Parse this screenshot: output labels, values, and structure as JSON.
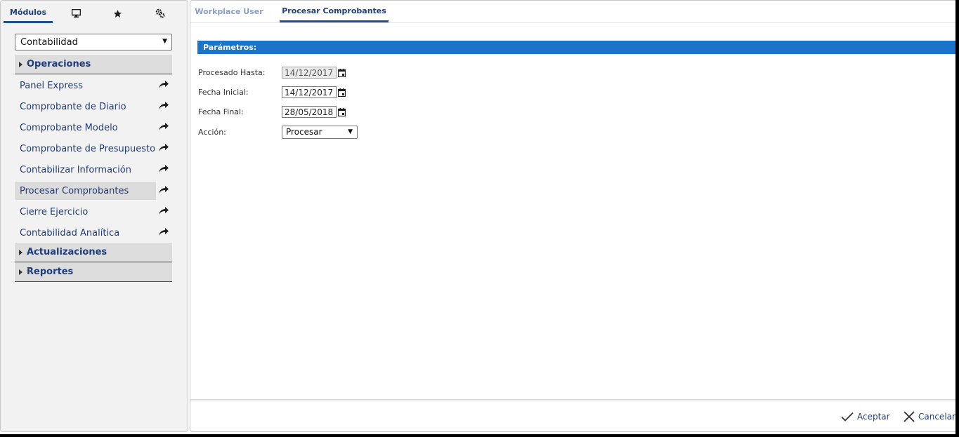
{
  "left_tabs": {
    "modules_label": "Módulos",
    "icons": [
      "monitor-icon",
      "star-icon",
      "settings-icon"
    ]
  },
  "module_select": {
    "value": "Contabilidad"
  },
  "sections": {
    "operaciones": "Operaciones",
    "actualizaciones": "Actualizaciones",
    "reportes": "Reportes"
  },
  "menu_items": [
    {
      "label": "Panel Express"
    },
    {
      "label": "Comprobante de Diario"
    },
    {
      "label": "Comprobante Modelo"
    },
    {
      "label": "Comprobante de Presupuesto"
    },
    {
      "label": "Contabilizar Información"
    },
    {
      "label": "Procesar Comprobantes",
      "selected": true
    },
    {
      "label": "Cierre Ejercicio"
    },
    {
      "label": "Contabilidad Analítica"
    }
  ],
  "right_tabs": {
    "workplace": "Workplace User",
    "procesar": "Procesar Comprobantes"
  },
  "params": {
    "title": "Parámetros:",
    "procesado_hasta_label": "Procesado Hasta:",
    "procesado_hasta_value": "14/12/2017",
    "fecha_inicial_label": "Fecha Inicial:",
    "fecha_inicial_value": "14/12/2017",
    "fecha_final_label": "Fecha Final:",
    "fecha_final_value": "28/05/2018",
    "accion_label": "Acción:",
    "accion_value": "Procesar"
  },
  "footer": {
    "accept_label": "Aceptar",
    "cancel_label": "Cancelar"
  },
  "colors": {
    "brand_blue": "#1f4e99",
    "params_bar": "#1b74c9",
    "link_text": "#1f3d7a"
  }
}
